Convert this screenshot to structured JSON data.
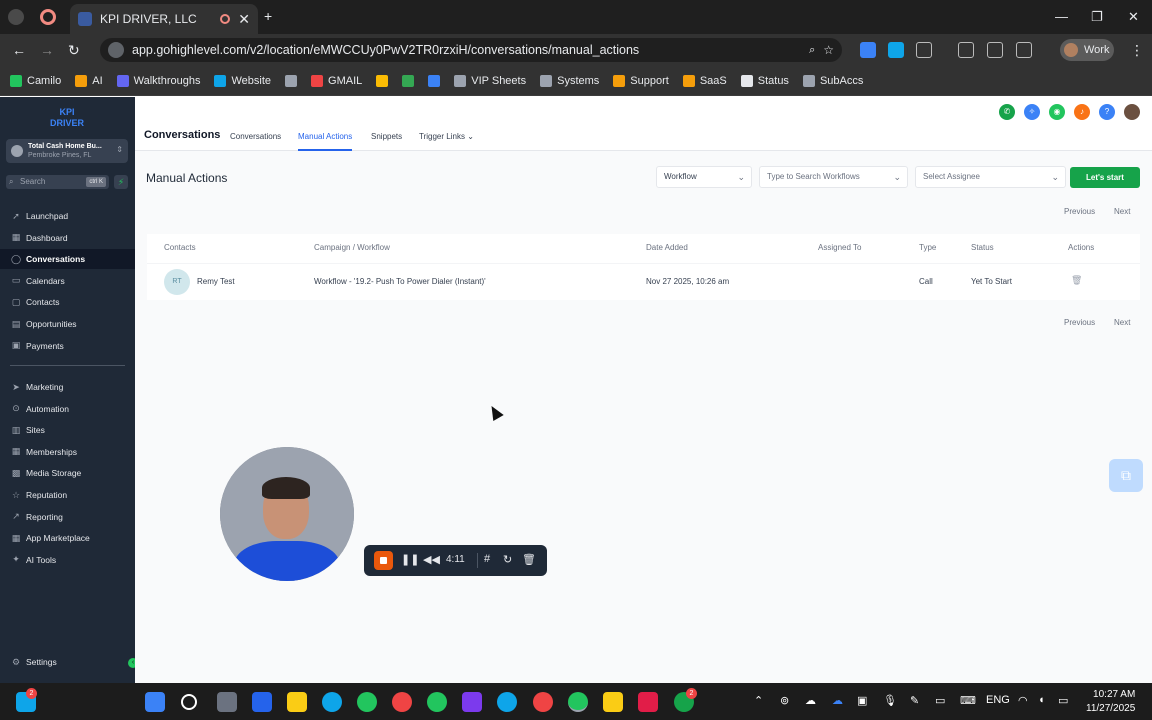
{
  "browser": {
    "tab_title": "KPI DRIVER, LLC",
    "url": "app.gohighlevel.com/v2/location/eMWCCUy0PwV2TR0rzxiH/conversations/manual_actions",
    "profile_label": "Work",
    "bookmarks": [
      {
        "label": "Camilo",
        "color": "#22c55e"
      },
      {
        "label": "AI",
        "color": "#f59e0b"
      },
      {
        "label": "Walkthroughs",
        "color": "#6366f1"
      },
      {
        "label": "Website",
        "color": "#0ea5e9"
      },
      {
        "label": "",
        "color": "#9ca3af"
      },
      {
        "label": "GMAIL",
        "color": "#ef4444"
      },
      {
        "label": "",
        "color": "#fbbc04"
      },
      {
        "label": "",
        "color": "#34a853"
      },
      {
        "label": "",
        "color": "#3b82f6"
      },
      {
        "label": "VIP Sheets",
        "color": "#9ca3af"
      },
      {
        "label": "Systems",
        "color": "#9ca3af"
      },
      {
        "label": "Support",
        "color": "#f59e0b"
      },
      {
        "label": "SaaS",
        "color": "#f59e0b"
      },
      {
        "label": "Status",
        "color": "#e5e7eb"
      },
      {
        "label": "SubAccs",
        "color": "#9ca3af"
      }
    ]
  },
  "sidebar": {
    "logo_line1": "KPI",
    "logo_line2": "DRIVER",
    "location_name": "Total Cash Home Bu...",
    "location_sub": "Pembroke Pines, FL",
    "search_placeholder": "Search",
    "search_kbd": "ctrl K",
    "nav_top": [
      {
        "label": "Launchpad",
        "icon": "rocket-icon",
        "glyph": "➚"
      },
      {
        "label": "Dashboard",
        "icon": "grid-icon",
        "glyph": "▦"
      },
      {
        "label": "Conversations",
        "icon": "chat-icon",
        "glyph": "◯",
        "active": true
      },
      {
        "label": "Calendars",
        "icon": "calendar-icon",
        "glyph": "▭"
      },
      {
        "label": "Contacts",
        "icon": "contacts-icon",
        "glyph": "▢"
      },
      {
        "label": "Opportunities",
        "icon": "funnel-icon",
        "glyph": "▤"
      },
      {
        "label": "Payments",
        "icon": "card-icon",
        "glyph": "▣"
      }
    ],
    "nav_bottom": [
      {
        "label": "Marketing",
        "icon": "megaphone-icon",
        "glyph": "➤"
      },
      {
        "label": "Automation",
        "icon": "automation-icon",
        "glyph": "⊙"
      },
      {
        "label": "Sites",
        "icon": "globe-icon",
        "glyph": "▥"
      },
      {
        "label": "Memberships",
        "icon": "membership-icon",
        "glyph": "▦"
      },
      {
        "label": "Media Storage",
        "icon": "media-icon",
        "glyph": "▩"
      },
      {
        "label": "Reputation",
        "icon": "star-icon",
        "glyph": "☆"
      },
      {
        "label": "Reporting",
        "icon": "chart-icon",
        "glyph": "↗"
      },
      {
        "label": "App Marketplace",
        "icon": "apps-icon",
        "glyph": "▦"
      },
      {
        "label": "AI Tools",
        "icon": "ai-icon",
        "glyph": "✦"
      }
    ],
    "settings_label": "Settings"
  },
  "header": {
    "title": "Conversations",
    "tabs": [
      "Conversations",
      "Manual Actions",
      "Snippets",
      "Trigger Links"
    ],
    "active_tab": "Manual Actions"
  },
  "content": {
    "page_title": "Manual Actions",
    "filter_type": "Workflow",
    "search_placeholder": "Type to Search Workflows",
    "assignee_placeholder": "Select Assignee",
    "start_button": "Let's start",
    "prev_label": "Previous",
    "next_label": "Next",
    "columns": [
      "Contacts",
      "Campaign / Workflow",
      "Date Added",
      "Assigned To",
      "Type",
      "Status",
      "Actions"
    ],
    "rows": [
      {
        "initials": "RT",
        "contact": "Remy Test",
        "workflow": "Workflow - '19.2- Push To Power Dialer (Instant)'",
        "date_added": "Nov 27 2025, 10:26 am",
        "assigned_to": "",
        "type": "Call",
        "status": "Yet To Start"
      }
    ]
  },
  "recorder": {
    "time": "4:11"
  },
  "taskbar": {
    "time": "10:27 AM",
    "date": "11/27/2025",
    "lang": "ENG",
    "badge_left": "2",
    "badge_whatsapp": "2"
  },
  "colors": {
    "accent": "#2563eb",
    "start_button": "#16a34a",
    "sidebar": "#1f2937"
  }
}
